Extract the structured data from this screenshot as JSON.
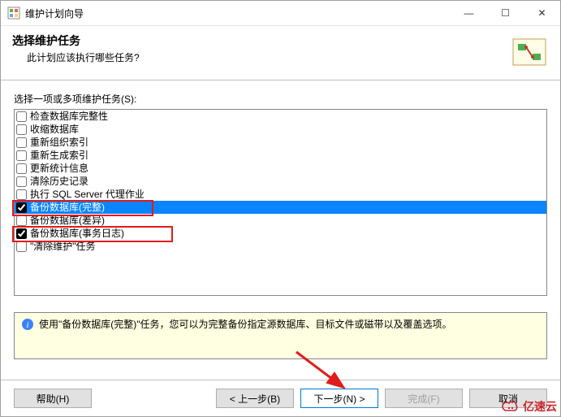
{
  "window": {
    "title": "维护计划向导"
  },
  "controls": {
    "minimize": "—",
    "maximize": "☐",
    "close": "✕"
  },
  "header": {
    "title": "选择维护任务",
    "subtitle": "此计划应该执行哪些任务?"
  },
  "list_label": "选择一项或多项维护任务(S):",
  "tasks": [
    {
      "label": "检查数据库完整性",
      "checked": false,
      "selected": false
    },
    {
      "label": "收缩数据库",
      "checked": false,
      "selected": false
    },
    {
      "label": "重新组织索引",
      "checked": false,
      "selected": false
    },
    {
      "label": "重新生成索引",
      "checked": false,
      "selected": false
    },
    {
      "label": "更新统计信息",
      "checked": false,
      "selected": false
    },
    {
      "label": "清除历史记录",
      "checked": false,
      "selected": false
    },
    {
      "label": "执行 SQL Server 代理作业",
      "checked": false,
      "selected": false
    },
    {
      "label": "备份数据库(完整)",
      "checked": true,
      "selected": true
    },
    {
      "label": "备份数据库(差异)",
      "checked": false,
      "selected": false
    },
    {
      "label": "备份数据库(事务日志)",
      "checked": true,
      "selected": false
    },
    {
      "label": "\"清除维护\"任务",
      "checked": false,
      "selected": false
    }
  ],
  "description": "使用\"备份数据库(完整)\"任务，您可以为完整备份指定源数据库、目标文件或磁带以及覆盖选项。",
  "buttons": {
    "help": "帮助(H)",
    "back": "< 上一步(B)",
    "next": "下一步(N) >",
    "finish": "完成(F)",
    "cancel": "取消"
  },
  "watermark": "亿速云"
}
